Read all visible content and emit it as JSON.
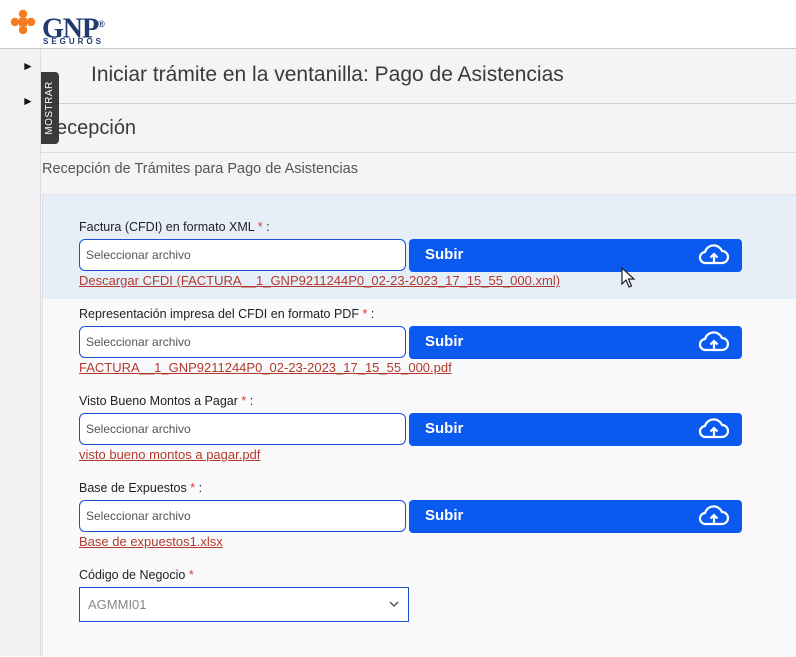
{
  "brand": {
    "name": "GNP",
    "registered": "®",
    "tagline": "SEGUROS"
  },
  "sidebar": {
    "toggle_label": "MOSTRAR"
  },
  "header": {
    "title": "Iniciar trámite en la ventanilla: Pago de Asistencias"
  },
  "section": {
    "title": "ecepción",
    "subtitle": "Recepción de Trámites para Pago de Asistencias"
  },
  "fields": [
    {
      "label": "Factura (CFDI) en formato XML",
      "placeholder": "Seleccionar archivo",
      "button": "Subir",
      "file": "Descargar CFDI (FACTURA__1_GNP9211244P0_02-23-2023_17_15_55_000.xml)"
    },
    {
      "label": "Representación impresa del CFDI en formato PDF",
      "placeholder": "Seleccionar archivo",
      "button": "Subir",
      "file": "FACTURA__1_GNP9211244P0_02-23-2023_17_15_55_000.pdf"
    },
    {
      "label": "Visto Bueno Montos a Pagar",
      "placeholder": "Seleccionar archivo",
      "button": "Subir",
      "file": "visto bueno montos a pagar.pdf"
    },
    {
      "label": "Base de Expuestos",
      "placeholder": "Seleccionar archivo",
      "button": "Subir",
      "file": "Base de expuestos1.xlsx"
    }
  ],
  "required_marker": "*",
  "label_suffix": ":",
  "codigo": {
    "label": "Código de Negocio",
    "value": "AGMMI01"
  },
  "colors": {
    "primary": "#0a5af0",
    "link": "#b23a2c",
    "brand_orange": "#f47b20",
    "brand_navy": "#1e3a6e"
  }
}
